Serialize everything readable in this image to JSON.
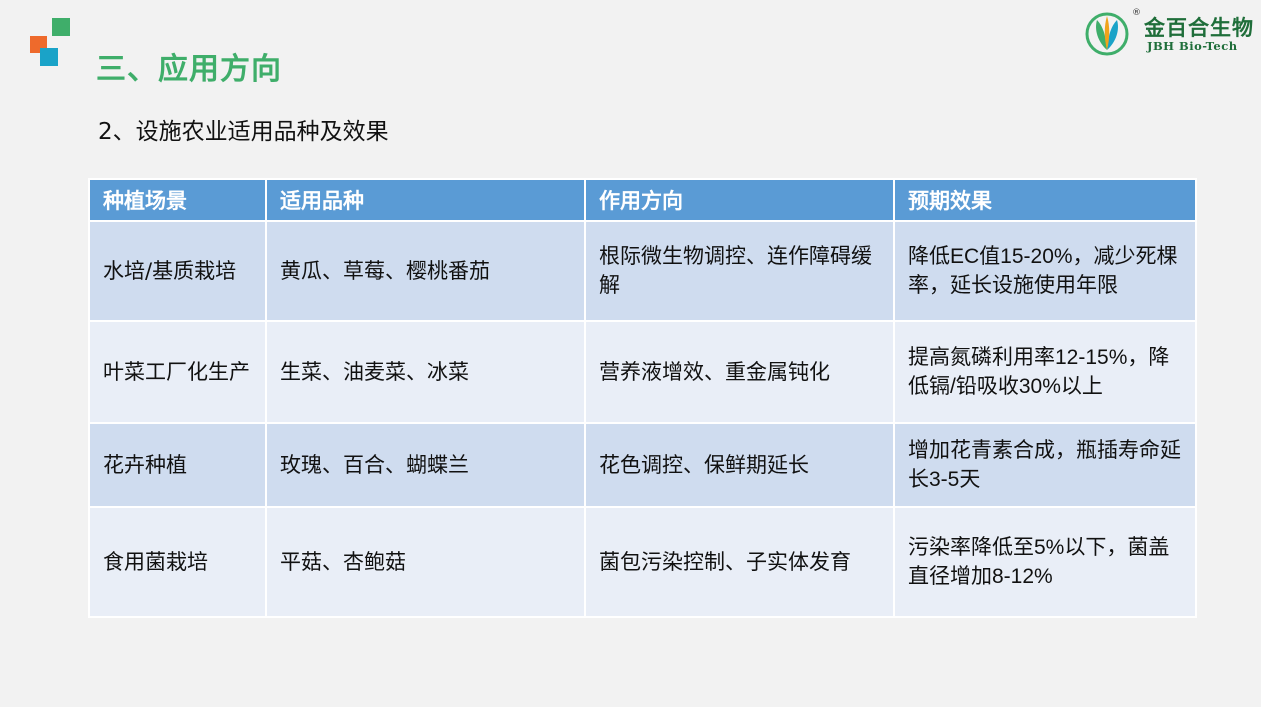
{
  "header": {
    "title": "三、应用方向",
    "subtitle": "2、设施农业适用品种及效果"
  },
  "logo": {
    "name_cn": "金百合生物",
    "name_en": "JBH Bio-Tech",
    "registered_mark": "®",
    "icon": "lily-leaf-icon"
  },
  "colors": {
    "title_green": "#3fae6a",
    "header_blue": "#5a9bd5",
    "row_odd": "#cfdcef",
    "row_even": "#e9eef7"
  },
  "table": {
    "columns": [
      "种植场景",
      "适用品种",
      "作用方向",
      "预期效果"
    ],
    "rows": [
      {
        "scene": "水培/基质栽培",
        "varieties": "黄瓜、草莓、樱桃番茄",
        "direction": "根际微生物调控、连作障碍缓解",
        "effect": "降低EC值15-20%，减少死棵率，延长设施使用年限"
      },
      {
        "scene": "叶菜工厂化生产",
        "varieties": "生菜、油麦菜、冰菜",
        "direction": "营养液增效、重金属钝化",
        "effect": "提高氮磷利用率12-15%，降低镉/铅吸收30%以上"
      },
      {
        "scene": "花卉种植",
        "varieties": "玫瑰、百合、蝴蝶兰",
        "direction": "花色调控、保鲜期延长",
        "effect": "增加花青素合成，瓶插寿命延长3-5天"
      },
      {
        "scene": "食用菌栽培",
        "varieties": "平菇、杏鲍菇",
        "direction": "菌包污染控制、子实体发育",
        "effect": "污染率降低至5%以下，菌盖直径增加8-12%"
      }
    ]
  }
}
